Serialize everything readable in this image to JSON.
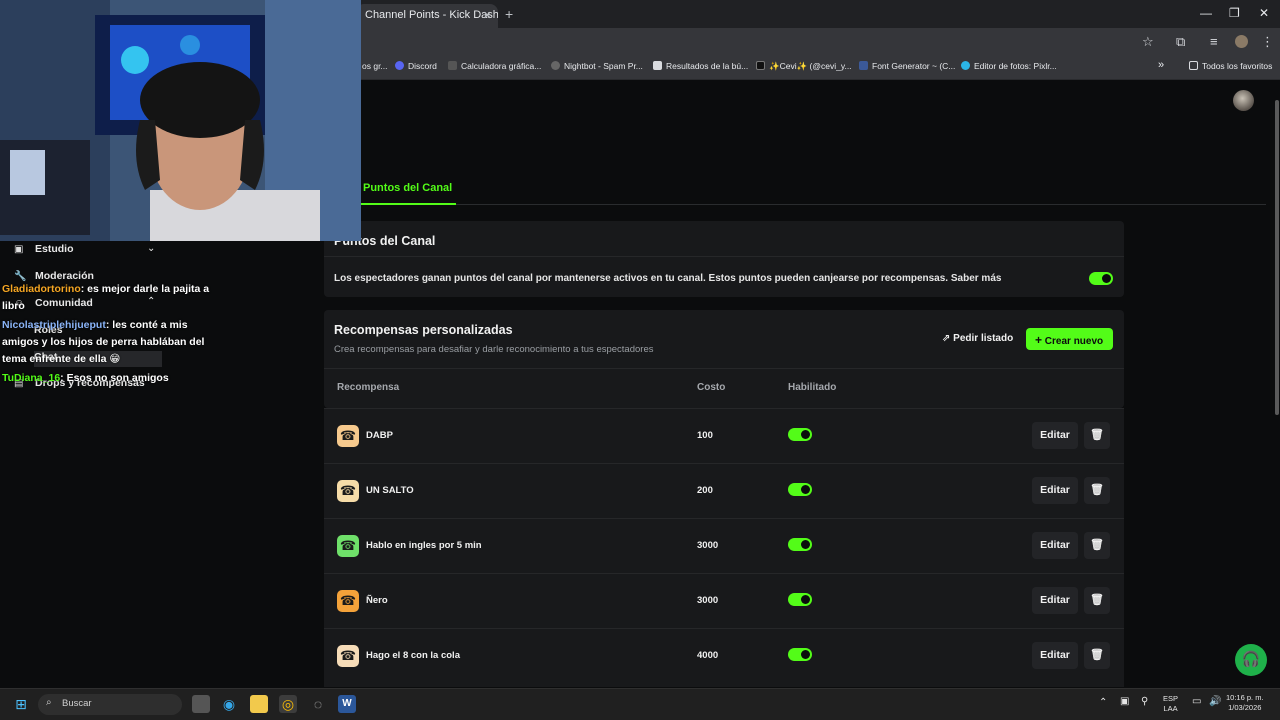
{
  "browser": {
    "tab_title": "Channel Points - Kick Dashboard",
    "tab_close": "✕",
    "new_tab": "+",
    "window_controls": [
      "—",
      "❐",
      "✕"
    ],
    "bookmarks": [
      {
        "label": "os gr...",
        "color": "#3c3c3c"
      },
      {
        "label": "Discord",
        "color": "#5865f2"
      },
      {
        "label": "Calculadora gráfica...",
        "color": "#2d2d2d"
      },
      {
        "label": "Nightbot - Spam Pr...",
        "color": "#444444"
      },
      {
        "label": "Resultados de la bú...",
        "color": "#dadce0"
      },
      {
        "label": "✨Cevi✨ (@cevi_y...",
        "color": "#111111"
      },
      {
        "label": "Font Generator ~ (C...",
        "color": "#3b5998"
      },
      {
        "label": "Editor de fotos: Pixlr...",
        "color": "#2bb4e5"
      }
    ],
    "bookmarks_more": "»",
    "all_favorites": "Todos los favoritos"
  },
  "sidebar": {
    "items": [
      {
        "label": "Estudio",
        "icon": "studio-icon"
      },
      {
        "label": "Moderación",
        "icon": "wrench-icon"
      },
      {
        "label": "Comunidad",
        "icon": "community-icon"
      },
      {
        "label": "Roles",
        "icon": "roles-icon"
      },
      {
        "label": "Chat",
        "icon": "chat-icon"
      },
      {
        "label": "Drops y recompensas",
        "icon": "drops-icon"
      }
    ]
  },
  "chat_overlay": [
    {
      "user": "Gladiadortorino",
      "user_color": "#f5a623",
      "text": ": es mejor darle la pajita a libro"
    },
    {
      "user": "Nicolastriplehijueput",
      "user_color": "#8ab4f8",
      "text": ": les conté a mis amigos y los hijos de perra hablában del tema enfrente de ella 😁"
    },
    {
      "user": "TuDiana_16",
      "user_color": "#53fc18",
      "text": ": Esos no son amigos"
    }
  ],
  "page": {
    "active_tab": "Puntos del Canal",
    "channel_points": {
      "title": "Puntos del Canal",
      "description": "Los espectadores ganan puntos del canal por mantenerse activos en tu canal. Estos puntos pueden canjearse por recompensas. Saber más",
      "enabled": true
    },
    "custom_rewards": {
      "title": "Recompensas personalizadas",
      "subtitle": "Crea recompensas para desafiar y darle reconocimiento a tus espectadores",
      "request_list_label": "Pedir listado",
      "create_new_label": "Crear nuevo",
      "columns": [
        "Recompensa",
        "Costo",
        "Habilitado"
      ],
      "edit_label": "Editar",
      "rows": [
        {
          "name": "DABP",
          "cost": "100",
          "enabled": true,
          "icon_color": "#f6c98d"
        },
        {
          "name": "UN SALTO",
          "cost": "200",
          "enabled": true,
          "icon_color": "#f6dca8"
        },
        {
          "name": "Hablo en ingles por 5 min",
          "cost": "3000",
          "enabled": true,
          "icon_color": "#6fe06a"
        },
        {
          "name": "Ñero",
          "cost": "3000",
          "enabled": true,
          "icon_color": "#f4a23a"
        },
        {
          "name": "Hago el 8 con la cola",
          "cost": "4000",
          "enabled": true,
          "icon_color": "#f6dcb8"
        }
      ]
    }
  },
  "taskbar": {
    "search_placeholder": "Buscar",
    "lang_top": "ESP",
    "lang_bottom": "LAA",
    "time": "10:16 p. m.",
    "date": "1/03/2026"
  },
  "colors": {
    "accent": "#53fc18",
    "background": "#0b0c0d",
    "card": "#18191b"
  }
}
